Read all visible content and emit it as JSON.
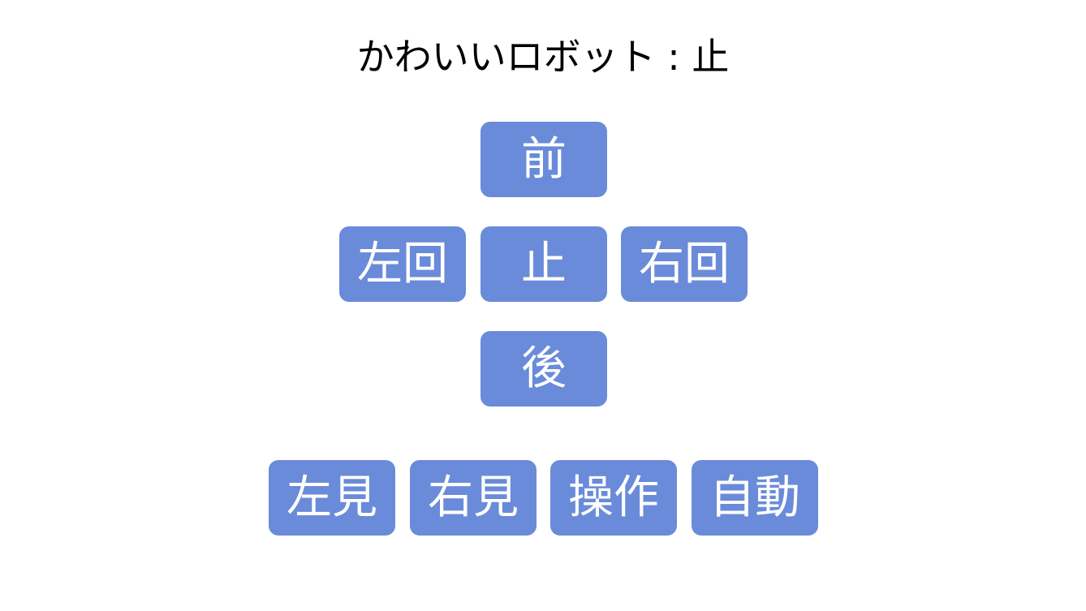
{
  "header": {
    "title": "かわいいロボット : 止"
  },
  "colors": {
    "button_bg": "#6a8bd9",
    "button_text": "#ffffff",
    "title_text": "#000000",
    "background": "#ffffff"
  },
  "drive_pad": {
    "forward_label": "前",
    "rotate_left_label": "左回",
    "stop_label": "止",
    "rotate_right_label": "右回",
    "back_label": "後"
  },
  "bottom_row": {
    "look_left_label": "左見",
    "look_right_label": "右見",
    "manual_label": "操作",
    "auto_label": "自動"
  }
}
